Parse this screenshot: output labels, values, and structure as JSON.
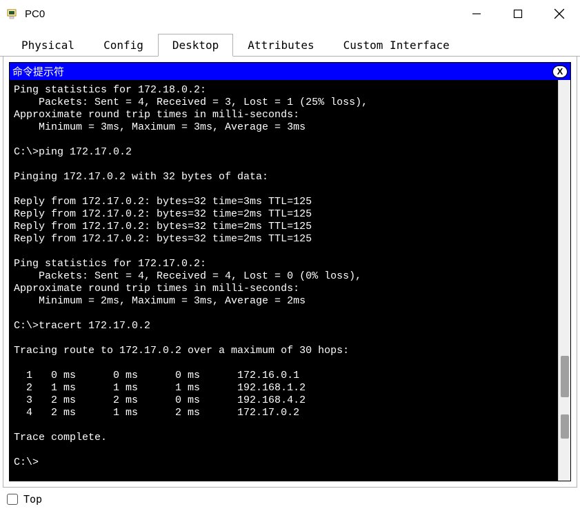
{
  "window": {
    "title": "PC0"
  },
  "tabs": {
    "items": [
      {
        "label": "Physical",
        "active": false
      },
      {
        "label": "Config",
        "active": false
      },
      {
        "label": "Desktop",
        "active": true
      },
      {
        "label": "Attributes",
        "active": false
      },
      {
        "label": "Custom Interface",
        "active": false
      }
    ]
  },
  "console": {
    "title": "命令提示符",
    "close_label": "X",
    "lines": [
      "Ping statistics for 172.18.0.2:",
      "    Packets: Sent = 4, Received = 3, Lost = 1 (25% loss),",
      "Approximate round trip times in milli-seconds:",
      "    Minimum = 3ms, Maximum = 3ms, Average = 3ms",
      "",
      "C:\\>ping 172.17.0.2",
      "",
      "Pinging 172.17.0.2 with 32 bytes of data:",
      "",
      "Reply from 172.17.0.2: bytes=32 time=3ms TTL=125",
      "Reply from 172.17.0.2: bytes=32 time=2ms TTL=125",
      "Reply from 172.17.0.2: bytes=32 time=2ms TTL=125",
      "Reply from 172.17.0.2: bytes=32 time=2ms TTL=125",
      "",
      "Ping statistics for 172.17.0.2:",
      "    Packets: Sent = 4, Received = 4, Lost = 0 (0% loss),",
      "Approximate round trip times in milli-seconds:",
      "    Minimum = 2ms, Maximum = 3ms, Average = 2ms",
      "",
      "C:\\>tracert 172.17.0.2",
      "",
      "Tracing route to 172.17.0.2 over a maximum of 30 hops: ",
      "",
      "  1   0 ms      0 ms      0 ms      172.16.0.1",
      "  2   1 ms      1 ms      1 ms      192.168.1.2",
      "  3   2 ms      2 ms      0 ms      192.168.4.2",
      "  4   2 ms      1 ms      2 ms      172.17.0.2",
      "",
      "Trace complete.",
      "",
      "C:\\>"
    ]
  },
  "footer": {
    "top_label": "Top",
    "top_checked": false
  }
}
